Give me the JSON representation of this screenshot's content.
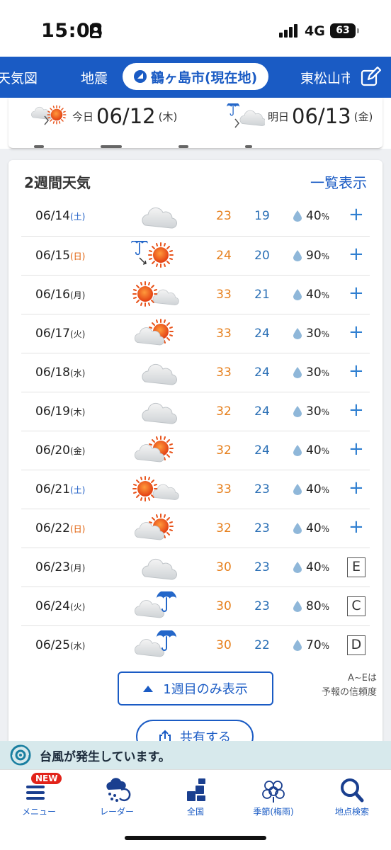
{
  "status_bar": {
    "time": "15:03",
    "network": "4G",
    "battery": "63"
  },
  "topnav": {
    "items": [
      "天気図",
      "地震",
      "鶴ヶ島市(現在地)",
      "東松山市"
    ],
    "active_location": "鶴ヶ島市(現在地)"
  },
  "date_strip": {
    "today": {
      "label": "今日",
      "date": "06/12",
      "dow": "(木)",
      "icon": "cloudy-then-sunny-icon"
    },
    "tomorrow": {
      "label": "明日",
      "date": "06/13",
      "dow": "(金)",
      "icon": "rain-then-cloudy-icon"
    }
  },
  "forecast": {
    "title": "2週間天気",
    "link_label": "一覧表示",
    "rows": [
      {
        "date": "06/14",
        "dow": "(土)",
        "dow_type": "sat",
        "icon": "cloudy-icon",
        "high": "23",
        "low": "19",
        "pop": "40",
        "pop_unit": "%",
        "reliability": ""
      },
      {
        "date": "06/15",
        "dow": "(日)",
        "dow_type": "sun",
        "icon": "rain-then-sunny-icon",
        "high": "24",
        "low": "20",
        "pop": "90",
        "pop_unit": "%",
        "reliability": ""
      },
      {
        "date": "06/16",
        "dow": "(月)",
        "dow_type": "week",
        "icon": "sunny-with-clouds-icon",
        "high": "33",
        "low": "21",
        "pop": "40",
        "pop_unit": "%",
        "reliability": ""
      },
      {
        "date": "06/17",
        "dow": "(火)",
        "dow_type": "week",
        "icon": "cloudy-with-sun-icon",
        "high": "33",
        "low": "24",
        "pop": "30",
        "pop_unit": "%",
        "reliability": ""
      },
      {
        "date": "06/18",
        "dow": "(水)",
        "dow_type": "week",
        "icon": "cloudy-icon",
        "high": "33",
        "low": "24",
        "pop": "30",
        "pop_unit": "%",
        "reliability": ""
      },
      {
        "date": "06/19",
        "dow": "(木)",
        "dow_type": "week",
        "icon": "cloudy-icon",
        "high": "32",
        "low": "24",
        "pop": "30",
        "pop_unit": "%",
        "reliability": ""
      },
      {
        "date": "06/20",
        "dow": "(金)",
        "dow_type": "week",
        "icon": "cloudy-with-sun-icon",
        "high": "32",
        "low": "24",
        "pop": "40",
        "pop_unit": "%",
        "reliability": ""
      },
      {
        "date": "06/21",
        "dow": "(土)",
        "dow_type": "sat",
        "icon": "sunny-with-clouds-icon",
        "high": "33",
        "low": "23",
        "pop": "40",
        "pop_unit": "%",
        "reliability": ""
      },
      {
        "date": "06/22",
        "dow": "(日)",
        "dow_type": "sun",
        "icon": "cloudy-with-sun-icon",
        "high": "32",
        "low": "23",
        "pop": "40",
        "pop_unit": "%",
        "reliability": ""
      },
      {
        "date": "06/23",
        "dow": "(月)",
        "dow_type": "week",
        "icon": "cloudy-icon",
        "high": "30",
        "low": "23",
        "pop": "40",
        "pop_unit": "%",
        "reliability": "E"
      },
      {
        "date": "06/24",
        "dow": "(火)",
        "dow_type": "week",
        "icon": "cloudy-with-umbrella-icon",
        "high": "30",
        "low": "23",
        "pop": "80",
        "pop_unit": "%",
        "reliability": "C"
      },
      {
        "date": "06/25",
        "dow": "(水)",
        "dow_type": "week",
        "icon": "cloudy-with-umbrella-icon",
        "high": "30",
        "low": "22",
        "pop": "70",
        "pop_unit": "%",
        "reliability": "D"
      }
    ],
    "show_week_label": "1週目のみ表示",
    "reliability_note_line1": "A~Eは",
    "reliability_note_line2": "予報の信頼度",
    "share_label": "共有する"
  },
  "typhoon_banner": {
    "text": "台風が発生しています。"
  },
  "tabbar": {
    "items": [
      {
        "label": "メニュー",
        "badge": "NEW"
      },
      {
        "label": "レーダー"
      },
      {
        "label": "全国"
      },
      {
        "label": "季節(梅雨)"
      },
      {
        "label": "地点検索"
      }
    ]
  },
  "colors": {
    "brand_blue": "#1a5bc4",
    "high_temp": "#e67e1a",
    "low_temp": "#2a6fb5",
    "sun_orange": "#e8541c"
  }
}
